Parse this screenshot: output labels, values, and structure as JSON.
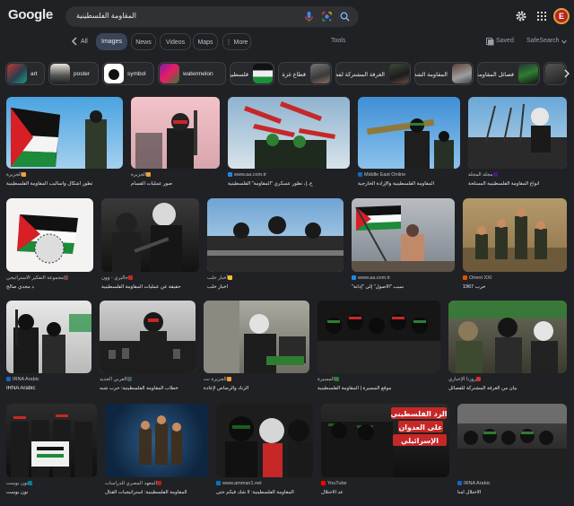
{
  "header": {
    "logo": "Google",
    "query": "المقاومة الفلسطينية",
    "avatar_letter": "E",
    "colors": {
      "background": "#202124",
      "searchbox": "#303134",
      "avatar": "#b3261e"
    }
  },
  "nav": {
    "tabs": [
      "All",
      "Images",
      "News",
      "Videos",
      "Maps",
      "More"
    ],
    "tools": "Tools",
    "saved": "Saved",
    "safesearch": "SafeSearch"
  },
  "chips": [
    {
      "label": "art"
    },
    {
      "label": "poster"
    },
    {
      "label": "symbol"
    },
    {
      "label": "watermelon"
    },
    {
      "label": "فلسطين"
    },
    {
      "label": "قطاع غزة"
    },
    {
      "label": "الغرفة المشتركة لفصائل"
    },
    {
      "label": "المقاومة الشعبية"
    },
    {
      "label": "فصائل المقاومة"
    }
  ],
  "results": [
    {
      "source": "الجزيرة",
      "caption": "تطور أشكال وأساليب المقاومة الفلسطينية"
    },
    {
      "source": "الجزيرة",
      "caption": "صور عمليات القسام"
    },
    {
      "source": "www.aa.com.tr",
      "caption": "ح..إ، تطور عسكري \"المقاومة\" الفلسطينية"
    },
    {
      "source": "Middle East Online",
      "caption": "المقاومة الفلسطينية والإرادة الخارجية"
    },
    {
      "source": "مجلة المجلة",
      "caption": "أنواع المقاومة الفلسطينية المسلحة"
    },
    {
      "source": "مجموعة التفكير الاستراتيجي",
      "caption": "د مجدي صالح"
    },
    {
      "source": "جاليري - وون",
      "caption": "حقيقة عن عمليات المقاومة الفلسطينية"
    },
    {
      "source": "أخبار حلب",
      "caption": "أخبار حلب"
    },
    {
      "source": "www.aa.com.tr",
      "caption": "سبب \"الأصول\" إلى \"إدانة\""
    },
    {
      "source": "Orient XXI",
      "caption": "حرب 1967"
    },
    {
      "source": "IRNA Arabic",
      "caption": "IRNA Arabic"
    },
    {
      "source": "العربي الجديد",
      "caption": "خطاب المقاومة الفلسطينية: حرب شبه"
    },
    {
      "source": "الجزيرة نت",
      "caption": "الزناد والرصاص لإعادة"
    },
    {
      "source": "المسيرة",
      "caption": "موقع المسيرة | المقاومة الفلسطينية"
    },
    {
      "source": "روزنا الإخباري",
      "caption": "بيان من الغرفة المشتركة للفصائل"
    },
    {
      "source": "نون بوست",
      "caption": "نون بوست"
    },
    {
      "source": "المعهد المصري للدراسات",
      "caption": "المقاومة الفلسطينية: استراتيجيات القتال"
    },
    {
      "source": "www.amman1.net",
      "caption": "المقاومة الفلسطينية: لا شك فيكم حتى"
    },
    {
      "source": "YouTube",
      "caption": "عد الاحتلال"
    },
    {
      "source": "IRNA Arabic",
      "caption": "الاحتلال أمنا"
    }
  ],
  "overlays": {
    "youtube_banner": [
      "الرد الفلسطيني",
      "على العدوان",
      "الإسرائيلي"
    ]
  }
}
